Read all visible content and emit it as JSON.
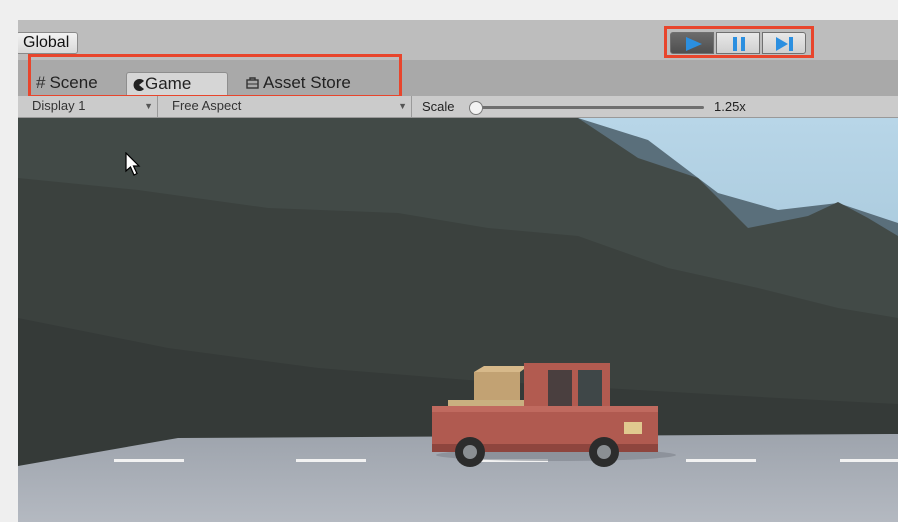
{
  "toolbar": {
    "global_label": "Global",
    "play": {
      "active": true
    },
    "pause": {
      "active": false
    },
    "step": {
      "active": false
    }
  },
  "tabs": [
    {
      "label": "Scene",
      "icon": "grid-icon",
      "active": false
    },
    {
      "label": "Game",
      "icon": "pacman-icon",
      "active": true
    },
    {
      "label": "Asset Store",
      "icon": "bag-icon",
      "active": false
    }
  ],
  "game_toolbar": {
    "display": "Display 1",
    "aspect": "Free Aspect",
    "scale_label": "Scale",
    "scale_value": "1.25x",
    "scale_fraction": 0.02
  },
  "colors": {
    "highlight": "#e8452c",
    "play_blue": "#2b8fe0",
    "truck_red": "#b05a50"
  }
}
